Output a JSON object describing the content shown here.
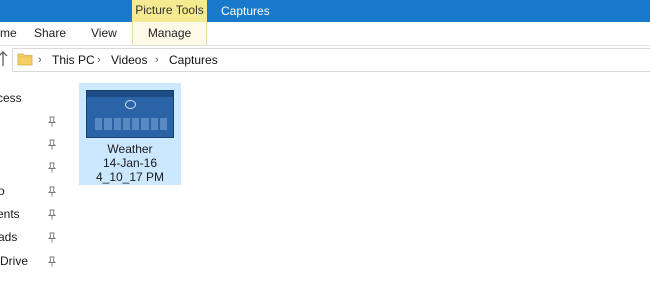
{
  "titlebar": {
    "context_tab": "Picture Tools",
    "title": "Captures"
  },
  "ribbon": {
    "tabs": [
      "me",
      "Share",
      "View",
      "Manage"
    ]
  },
  "address": {
    "crumbs": [
      "This PC",
      "Videos",
      "Captures"
    ]
  },
  "nav": {
    "items": [
      "ccess",
      "",
      "",
      "o",
      "ents",
      "ads",
      "Drive"
    ]
  },
  "files": [
    {
      "name_lines": [
        "Weather",
        "14-Jan-16",
        "4_10_17 PM"
      ],
      "selected": true
    }
  ],
  "colors": {
    "titlebar": "#1979ca",
    "context_tab": "#f5ea8f",
    "selection": "#cce8ff"
  }
}
